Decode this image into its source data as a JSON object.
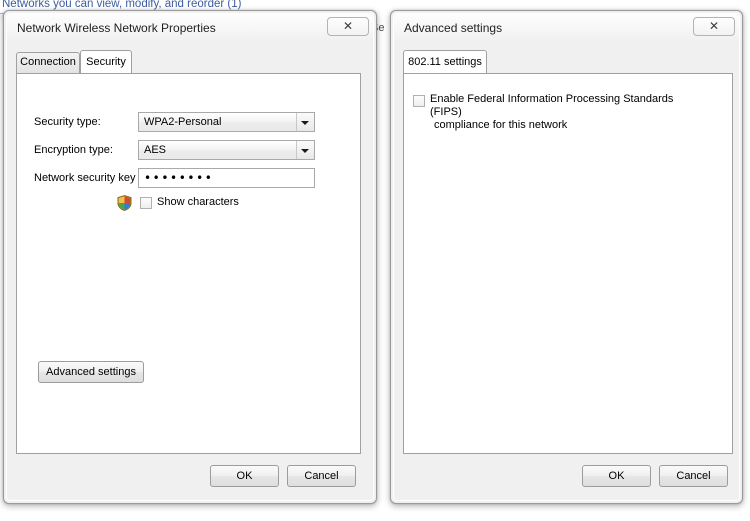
{
  "background": {
    "heading": "Networks you can view, modify, and reorder (1)",
    "partial_title": "Se"
  },
  "properties_dialog": {
    "title": "Network Wireless Network Properties",
    "close_glyph": "✕",
    "tabs": [
      {
        "label": "Connection",
        "active": false
      },
      {
        "label": "Security",
        "active": true
      }
    ],
    "fields": {
      "security_type_label": "Security type:",
      "security_type_value": "WPA2-Personal",
      "encryption_type_label": "Encryption type:",
      "encryption_type_value": "AES",
      "network_key_label": "Network security key",
      "network_key_value": "••••••••"
    },
    "show_characters": {
      "label": "Show characters",
      "shield_icon": "uac-shield-icon",
      "checked": false
    },
    "advanced_button": "Advanced settings",
    "ok_button": "OK",
    "cancel_button": "Cancel"
  },
  "advanced_dialog": {
    "title": "Advanced settings",
    "close_glyph": "✕",
    "tabs": [
      {
        "label": "802.11 settings",
        "active": true
      }
    ],
    "fips": {
      "line1": "Enable Federal Information Processing Standards (FIPS)",
      "line2": "compliance for this network",
      "checked": false
    },
    "ok_button": "OK",
    "cancel_button": "Cancel"
  },
  "colors": {
    "window_face": "#f0f0f0",
    "panel": "#ffffff",
    "border": "#9a9a9a",
    "heading_blue": "#1b3f8f"
  }
}
